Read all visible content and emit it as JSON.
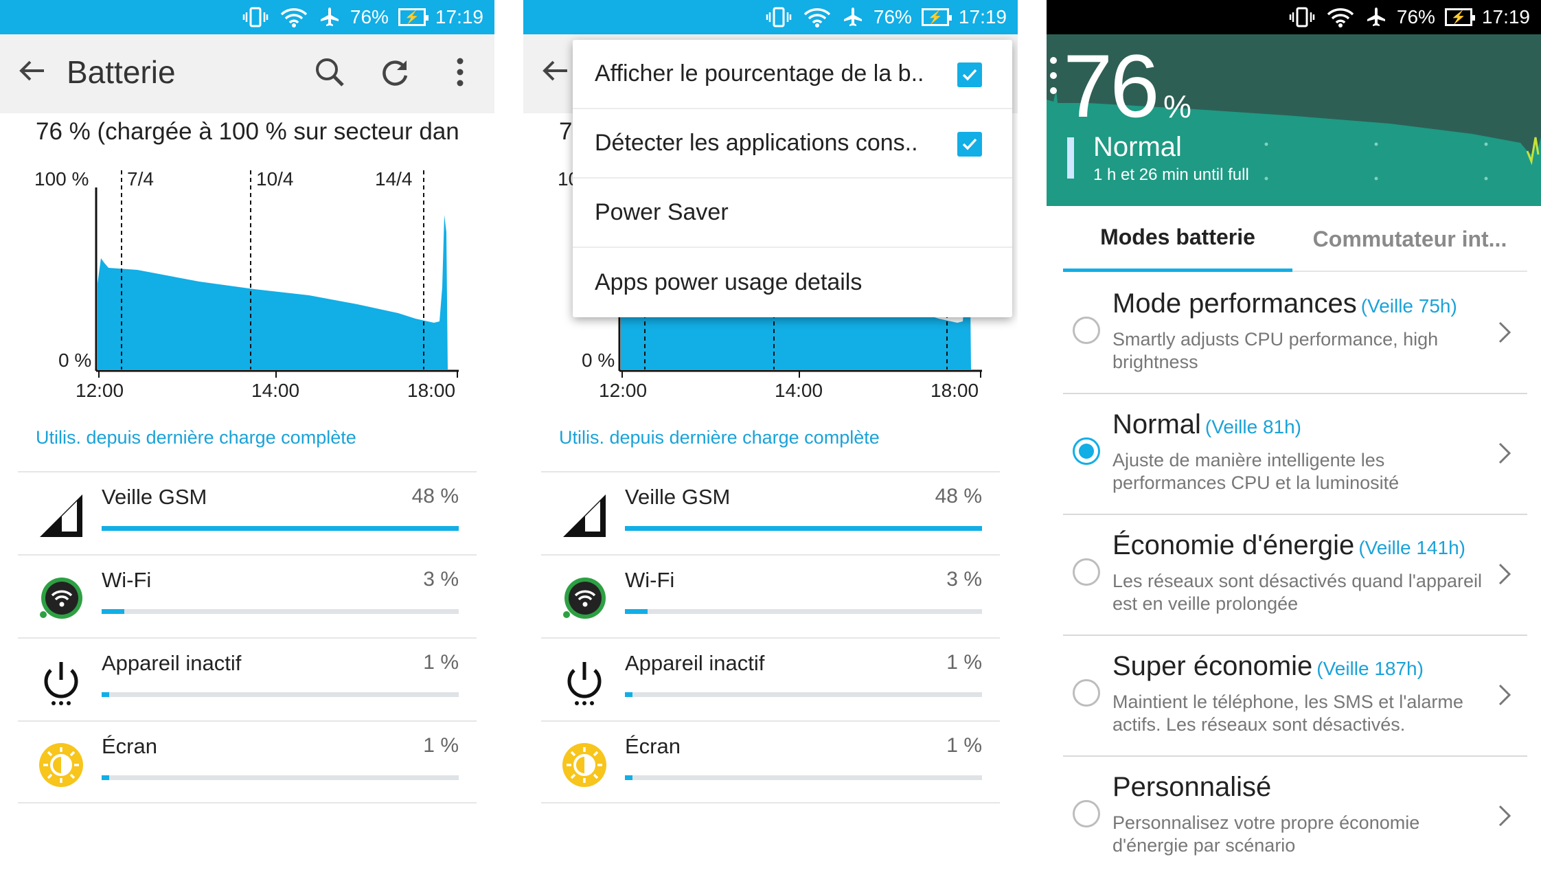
{
  "status": {
    "battery": "76%",
    "time": "17:19"
  },
  "panel1": {
    "title": "Batterie",
    "summary": "76 % (chargée à 100 % sur secteur dan",
    "chart_labels": {
      "y_top": "100 %",
      "y_bottom": "0 %",
      "dates": [
        "7/4",
        "10/4",
        "14/4"
      ],
      "times": [
        "12:00",
        "14:00",
        "18:00"
      ]
    },
    "link": "Utilis. depuis dernière charge complète",
    "items": [
      {
        "name": "Veille GSM",
        "percent": "48 %",
        "value": 48
      },
      {
        "name": "Wi-Fi",
        "percent": "3 %",
        "value": 3
      },
      {
        "name": "Appareil inactif",
        "percent": "1 %",
        "value": 1
      },
      {
        "name": "Écran",
        "percent": "1 %",
        "value": 1
      }
    ]
  },
  "panel2": {
    "summary": "7",
    "y_label_partial": "10",
    "menu": [
      {
        "label": "Afficher le pourcentage de la b..",
        "checked": true
      },
      {
        "label": "Détecter les applications cons..",
        "checked": true
      },
      {
        "label": "Power Saver",
        "checked": false
      },
      {
        "label": "Apps power usage details",
        "checked": false
      }
    ]
  },
  "panel3": {
    "level": "76",
    "level_unit": "%",
    "mode": "Normal",
    "eta": "1 h et 26 min until full",
    "tabs": [
      "Modes batterie",
      "Commutateur int..."
    ],
    "modes": [
      {
        "name": "Mode performances",
        "standby": "(Veille 75h)",
        "desc": "Smartly adjusts CPU performance, high brightness",
        "selected": false
      },
      {
        "name": "Normal",
        "standby": "(Veille 81h)",
        "desc": "Ajuste de manière intelligente les performances CPU et la luminosité",
        "selected": true
      },
      {
        "name": "Économie d'énergie",
        "standby": "(Veille 141h)",
        "desc": "Les réseaux sont désactivés quand l'appareil est en veille prolongée",
        "selected": false
      },
      {
        "name": "Super économie",
        "standby": "(Veille 187h)",
        "desc": "Maintient le téléphone, les SMS et l'alarme actifs. Les réseaux sont désactivés.",
        "selected": false
      },
      {
        "name": "Personnalisé",
        "standby": "",
        "desc": "Personnalisez votre propre économie d'énergie par scénario",
        "selected": false
      }
    ]
  },
  "colors": {
    "accent": "#12aee6",
    "hero": "#1d8270",
    "link": "#1aa2d8"
  },
  "icons": [
    "back-arrow-icon",
    "search-icon",
    "refresh-icon",
    "overflow-menu-icon",
    "signal-icon",
    "wifi-icon",
    "power-icon",
    "screen-icon",
    "vibrate-icon",
    "airplane-icon",
    "battery-charging-icon",
    "chevron-right-icon"
  ]
}
